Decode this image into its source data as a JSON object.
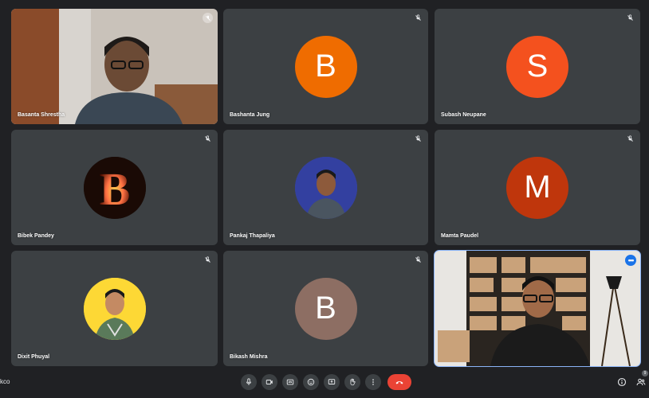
{
  "meeting": {
    "code": "kco"
  },
  "participants": [
    {
      "name": "Basanta Shrestha",
      "avatar_letter": "",
      "avatar_color": ""
    },
    {
      "name": "Bashanta Jung",
      "avatar_letter": "B",
      "avatar_color": "#ef6c00"
    },
    {
      "name": "Subash Neupane",
      "avatar_letter": "S",
      "avatar_color": "#f4511e"
    },
    {
      "name": "Bibek Pandey",
      "avatar_letter": "B",
      "avatar_color": "#1a1a1a"
    },
    {
      "name": "Pankaj Thapaliya",
      "avatar_letter": "",
      "avatar_color": "#3949ab"
    },
    {
      "name": "Mamta Paudel",
      "avatar_letter": "M",
      "avatar_color": "#bf360c"
    },
    {
      "name": "Dixit Phuyal",
      "avatar_letter": "",
      "avatar_color": "#fdd835"
    },
    {
      "name": "Bikash Mishra",
      "avatar_letter": "B",
      "avatar_color": "#8d6e63"
    }
  ],
  "toolbar": {
    "buttons": [
      "mic-icon",
      "camera-icon",
      "captions-icon",
      "emoji-icon",
      "present-icon",
      "raise-hand-icon",
      "more-options-icon"
    ],
    "end_call": "end-call-icon"
  },
  "right_controls": {
    "people_badge": "9"
  }
}
